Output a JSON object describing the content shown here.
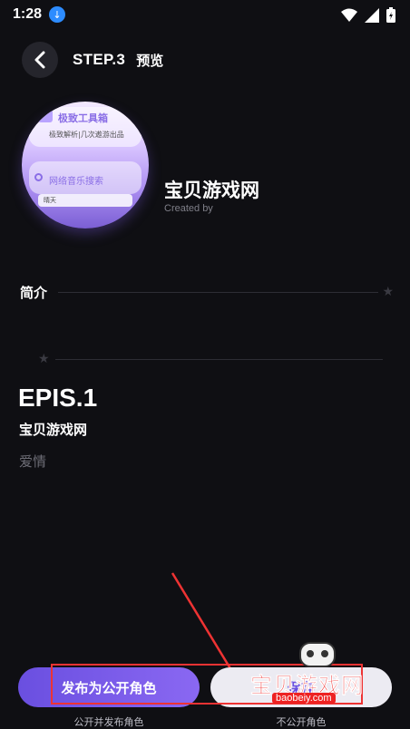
{
  "status": {
    "time": "1:28"
  },
  "header": {
    "step": "STEP.3",
    "title": "预览"
  },
  "avatar_preview": {
    "app_title": "极致工具箱",
    "subtitle": "极致解析|几次遨游出品",
    "search_label": "网络音乐搜索",
    "strip_text": "晴天"
  },
  "character": {
    "name": "宝贝游戏网",
    "created_by_label": "Created by"
  },
  "intro": {
    "label": "简介"
  },
  "episode": {
    "number": "EPIS.1",
    "name": "宝贝游戏网",
    "tag": "爱情"
  },
  "actions": {
    "publish_label": "发布为公开角色",
    "publish_sub": "公开并发布角色",
    "save_label": "保存",
    "save_sub": "不公开角色"
  },
  "watermark": {
    "text": "宝贝游戏网",
    "url": "baobeiy.com"
  },
  "colors": {
    "accent": "#7a5cea",
    "background": "#0f0f13",
    "annotation": "#e33333"
  }
}
